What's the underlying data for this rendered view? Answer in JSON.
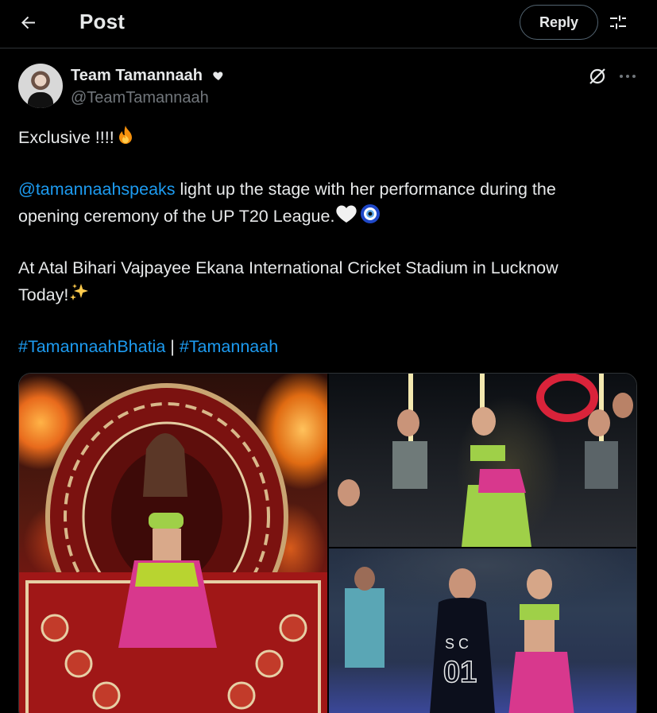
{
  "header": {
    "title": "Post",
    "reply_label": "Reply",
    "back_icon": "arrow-left-icon",
    "settings_icon": "sliders-icon"
  },
  "author": {
    "display_name": "Team Tamannaah",
    "badge_icon": "heart-icon",
    "handle": "@TeamTamannaah"
  },
  "tweet": {
    "line1": "Exclusive !!!!",
    "mention": "@tamannaahspeaks",
    "line2_rest": " light up the stage with her performance during the",
    "line3": "opening ceremony of the UP T20 League.",
    "line4": "At Atal Bihari Vajpayee Ekana International Cricket Stadium in Lucknow",
    "line5": "Today!",
    "hashtag1": "#TamannaahBhatia",
    "separator": " | ",
    "hashtag2": "#Tamannaah"
  },
  "colors": {
    "background": "#000000",
    "text": "#e7e9ea",
    "secondary": "#71767b",
    "link": "#1d9bf0",
    "border": "#2f3336"
  }
}
